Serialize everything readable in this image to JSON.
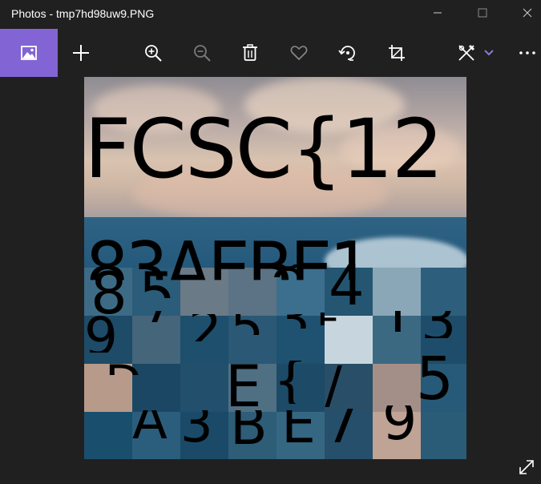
{
  "window": {
    "title": "Photos - tmp7hd98uw9.PNG",
    "minimize_icon": "minimize-icon",
    "maximize_icon": "maximize-icon",
    "close_icon": "close-icon"
  },
  "toolbar": {
    "view_icon": "image-view-icon",
    "add_icon": "plus-icon",
    "zoom_in_icon": "zoom-in-icon",
    "zoom_out_icon": "zoom-out-icon",
    "delete_icon": "trash-icon",
    "favorite_icon": "heart-icon",
    "rotate_icon": "rotate-icon",
    "crop_icon": "crop-icon",
    "edit_icon": "edit-draw-icon",
    "edit_chevron_icon": "chevron-down-icon",
    "more_icon": "more-icon",
    "accent_color": "#8264d4"
  },
  "image": {
    "line1": "FCSC{12",
    "fragments": [
      "83AEBE1",
      "8",
      "5",
      "8",
      "4",
      "9",
      "7",
      "2",
      "5",
      "3",
      "F",
      "1",
      "3",
      "D",
      "E",
      "A",
      "3",
      "B",
      "{",
      "E",
      "7",
      "8",
      "9",
      "5",
      "4",
      "/"
    ]
  },
  "footer": {
    "expand_icon": "expand-icon"
  }
}
